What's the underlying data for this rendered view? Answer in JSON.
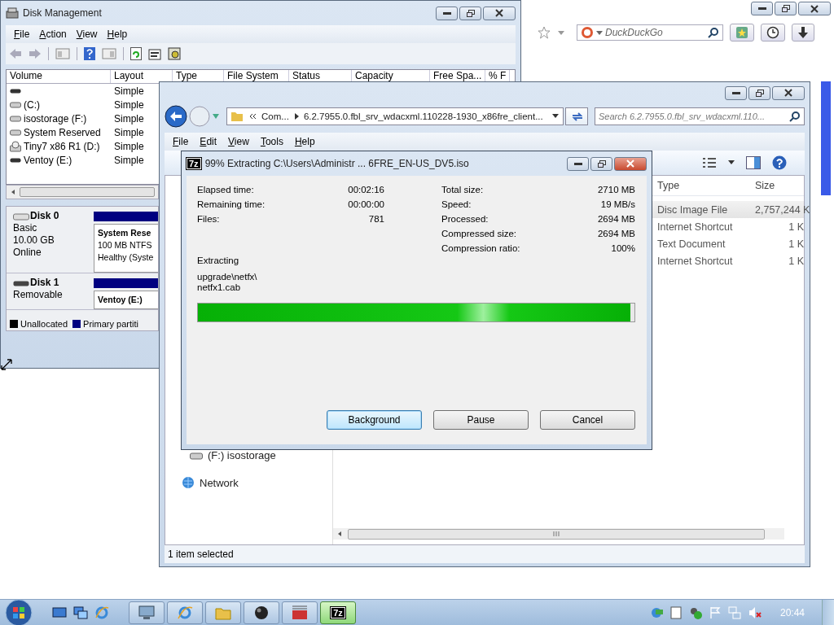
{
  "browser": {
    "search_placeholder": "DuckDuckGo"
  },
  "disk_management": {
    "title": "Disk Management",
    "menu": [
      "File",
      "Action",
      "View",
      "Help"
    ],
    "columns": [
      "Volume",
      "Layout",
      "Type",
      "File System",
      "Status",
      "Capacity",
      "Free Spa...",
      "% F"
    ],
    "volumes": [
      {
        "kind": "removable",
        "layout": "Simple"
      },
      {
        "kind": "hdd",
        "name": "(C:)",
        "layout": "Simple"
      },
      {
        "kind": "hdd",
        "name": "isostorage (F:)",
        "layout": "Simple"
      },
      {
        "kind": "hdd",
        "name": "System Reserved",
        "layout": "Simple"
      },
      {
        "kind": "disc",
        "name": "Tiny7 x86 R1 (D:)",
        "layout": "Simple"
      },
      {
        "kind": "removable",
        "name": "Ventoy (E:)",
        "layout": "Simple"
      }
    ],
    "disks": [
      {
        "kind": "hdd",
        "name": "Disk 0",
        "lines": [
          "Basic",
          "10.00 GB",
          "Online"
        ],
        "partition": {
          "name": "System Rese",
          "lines": [
            "100 MB NTFS",
            "Healthy (Syste"
          ]
        }
      },
      {
        "kind": "removable",
        "name": "Disk 1",
        "lines": [
          "Removable"
        ],
        "partition": {
          "name": "Ventoy  (E:)"
        }
      }
    ],
    "legend": [
      {
        "label": "Unallocated",
        "color": "#000000"
      },
      {
        "label": "Primary partiti",
        "color": "#000080"
      }
    ]
  },
  "explorer": {
    "breadcrumb": [
      "Com...",
      "6.2.7955.0.fbl_srv_wdacxml.110228-1930_x86fre_client..."
    ],
    "search_placeholder": "Search 6.2.7955.0.fbl_srv_wdacxml.110...",
    "menu": [
      "File",
      "Edit",
      "View",
      "Tools",
      "Help"
    ],
    "nav": [
      {
        "kind": "drive",
        "label": "(F:) isostorage"
      },
      {
        "kind": "network",
        "label": "Network"
      }
    ],
    "columns": [
      "Type",
      "Size"
    ],
    "files": [
      {
        "type": "Disc Image File",
        "size": "2,757,244 K",
        "selected": true
      },
      {
        "type": "Internet Shortcut",
        "size": "1 K",
        "selected": false
      },
      {
        "type": "Text Document",
        "size": "1 K",
        "selected": false
      },
      {
        "type": "Internet Shortcut",
        "size": "1 K",
        "selected": false
      }
    ],
    "status": "1 item selected"
  },
  "seven_zip": {
    "badge": "7z",
    "title": "99% Extracting C:\\Users\\Administr ... 6FRE_EN-US_DV5.iso",
    "left_stats": [
      {
        "label": "Elapsed time:",
        "value": "00:02:16"
      },
      {
        "label": "Remaining time:",
        "value": "00:00:00"
      },
      {
        "label": "Files:",
        "value": "781"
      }
    ],
    "right_stats": [
      {
        "label": "Total size:",
        "value": "2710 MB"
      },
      {
        "label": "Speed:",
        "value": "19 MB/s"
      },
      {
        "label": "Processed:",
        "value": "2694 MB"
      },
      {
        "label": "Compressed size:",
        "value": "2694 MB"
      },
      {
        "label": "Compression ratio:",
        "value": "100%"
      }
    ],
    "status": "Extracting",
    "path": [
      "upgrade\\netfx\\",
      "netfx1.cab"
    ],
    "progress": {
      "level": 0.99
    },
    "buttons": [
      {
        "label": "Background",
        "focused": true
      },
      {
        "label": "Pause",
        "focused": false
      },
      {
        "label": "Cancel",
        "focused": false
      }
    ]
  },
  "taskbar": {
    "tasks": [
      {
        "kind": "disk",
        "selected": false
      },
      {
        "kind": "ie",
        "selected": false
      },
      {
        "kind": "folder",
        "selected": false
      },
      {
        "kind": "ball",
        "selected": false
      },
      {
        "kind": "toolbox",
        "selected": false
      },
      {
        "kind": "sevenzip",
        "label": "7z",
        "selected": true
      }
    ],
    "clock": "20:44"
  }
}
